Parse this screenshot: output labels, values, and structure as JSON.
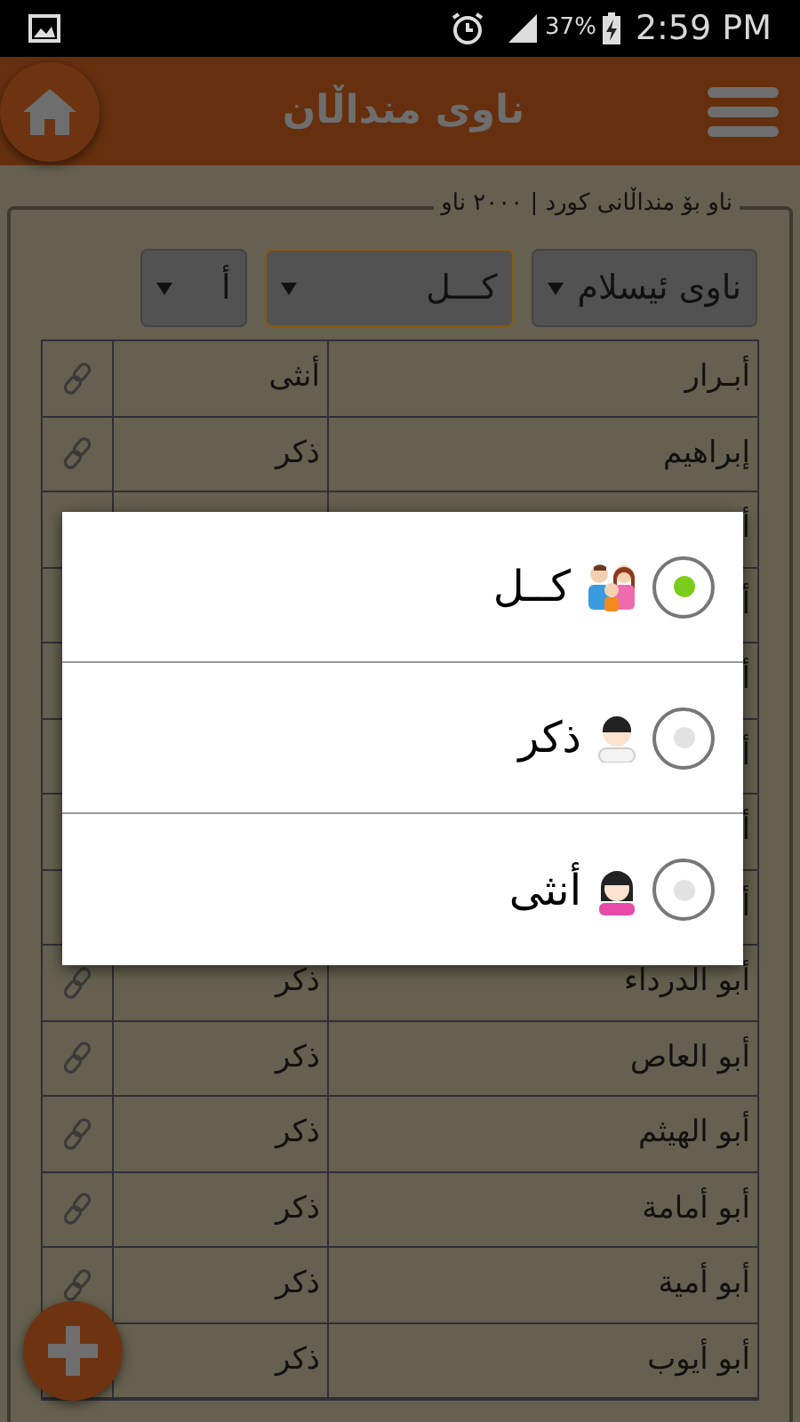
{
  "status_bar": {
    "battery": "37%",
    "time": "2:59 PM"
  },
  "header": {
    "title": "ناوی منداڵان"
  },
  "panel": {
    "legend": "ناو بۆ منداڵانی کورد | ٢٠٠٠ ناو",
    "filters": [
      {
        "value": "ناوی ئیسلام",
        "focused": false
      },
      {
        "value": "کـــل",
        "focused": true
      },
      {
        "value": "أ",
        "focused": false
      }
    ]
  },
  "table": {
    "rows": [
      {
        "name": "أبـرار",
        "gender": "أنثى"
      },
      {
        "name": "إبراهيم",
        "gender": "ذكر"
      },
      {
        "name": "أ"
      },
      {
        "name": "أ"
      },
      {
        "name": "أ"
      },
      {
        "name": "أ"
      },
      {
        "name": "أ"
      },
      {
        "name": "أ"
      },
      {
        "name": "أبو الدرداء",
        "gender": "ذكر"
      },
      {
        "name": "أبو العاص",
        "gender": "ذكر"
      },
      {
        "name": "أبو الهيثم",
        "gender": "ذكر"
      },
      {
        "name": "أبو أمامة",
        "gender": "ذكر"
      },
      {
        "name": "أبو أمية",
        "gender": "ذكر"
      },
      {
        "name": "أبو أيوب",
        "gender": "ذكر"
      }
    ]
  },
  "dialog": {
    "options": [
      {
        "label": "کــل",
        "kind": "all",
        "selected": true
      },
      {
        "label": "ذکر",
        "kind": "male",
        "selected": false
      },
      {
        "label": "أنثى",
        "kind": "female",
        "selected": false
      }
    ]
  }
}
